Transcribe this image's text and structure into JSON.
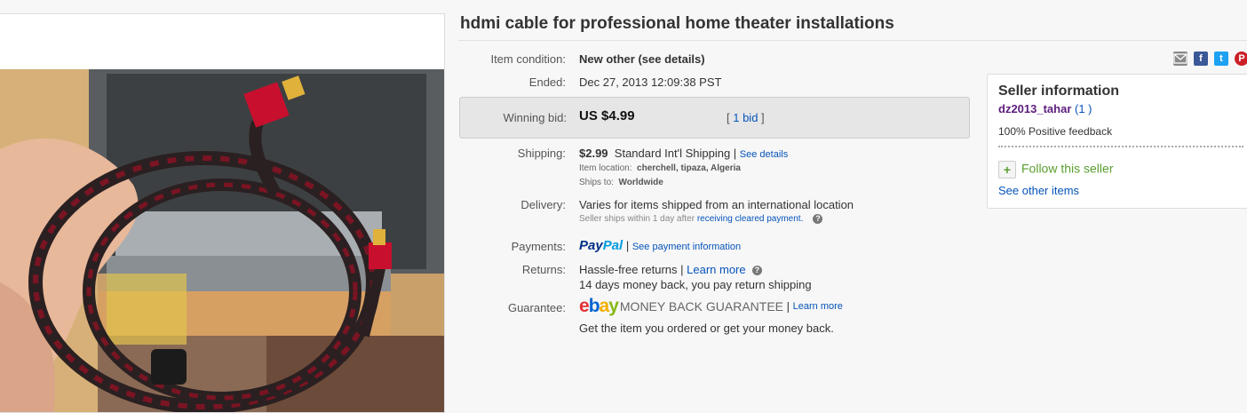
{
  "title": "hdmi cable for professional home theater installations",
  "details": {
    "condition_label": "Item condition:",
    "condition_value": "New other (see details)",
    "ended_label": "Ended:",
    "ended_value": "Dec 27, 2013  12:09:38 PST",
    "winning_bid_label": "Winning bid:",
    "winning_bid_value": "US $4.99",
    "bids_open": "[ ",
    "bids_link": "1 bid",
    "bids_close": " ]",
    "shipping_label": "Shipping:",
    "shipping_cost": "$2.99",
    "shipping_method": "Standard Int'l Shipping | ",
    "shipping_link": "See details",
    "item_location_label": "Item location:",
    "item_location_value": "cherchell, tipaza, Algeria",
    "ships_to_label": "Ships to:",
    "ships_to_value": "Worldwide",
    "delivery_label": "Delivery:",
    "delivery_value": "Varies for items shipped from an international location",
    "delivery_note": "Seller ships within 1 day after ",
    "delivery_link": "receiving cleared payment.",
    "help_glyph": "?",
    "payments_label": "Payments:",
    "paypal_pay": "Pay",
    "paypal_pal": "Pal",
    "payment_sep": " | ",
    "payment_link": "See payment information",
    "returns_label": "Returns:",
    "returns_value": "Hassle-free returns | ",
    "returns_link": "Learn more",
    "returns_detail": "14 days money back, you pay return shipping",
    "guarantee_label": "Guarantee:",
    "ebay_e": "e",
    "ebay_b": "b",
    "ebay_a": "a",
    "ebay_y": "y",
    "mbg_text": "MONEY BACK GUARANTEE",
    "guarantee_sep": " | ",
    "guarantee_link": "Learn more",
    "guarantee_detail": "Get the item you ordered or get your money back."
  },
  "share": {
    "facebook": "f",
    "twitter": "t",
    "pinterest": "P"
  },
  "seller": {
    "title": "Seller information",
    "username": "dz2013_tahar",
    "score": " (1 )",
    "feedback": "100% Positive feedback",
    "follow_plus": "+",
    "follow": "Follow this seller",
    "see_other": "See other items"
  },
  "colors": {
    "link": "#0654ba",
    "seller_name": "#5d1d7d",
    "follow_green": "#5a9e2f",
    "facebook": "#3b5998",
    "twitter": "#1da1f2",
    "pinterest": "#cb2027"
  },
  "icons": [
    "email-icon",
    "facebook-icon",
    "twitter-icon",
    "pinterest-icon",
    "plus-icon",
    "help-icon"
  ]
}
